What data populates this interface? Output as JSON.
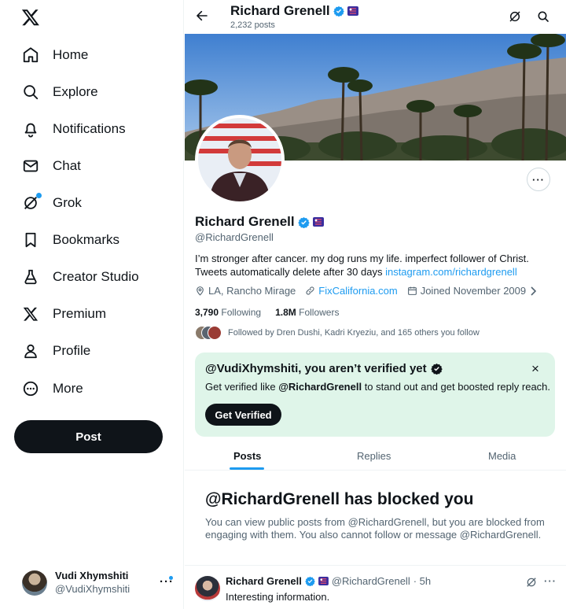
{
  "sidebar": {
    "logo": "x-logo-icon",
    "items": [
      {
        "label": "Home",
        "icon": "home-icon"
      },
      {
        "label": "Explore",
        "icon": "search-icon"
      },
      {
        "label": "Notifications",
        "icon": "bell-icon"
      },
      {
        "label": "Chat",
        "icon": "mail-icon"
      },
      {
        "label": "Grok",
        "icon": "grok-icon"
      },
      {
        "label": "Bookmarks",
        "icon": "bookmark-icon"
      },
      {
        "label": "Creator Studio",
        "icon": "flask-icon"
      },
      {
        "label": "Premium",
        "icon": "x-logo-icon"
      },
      {
        "label": "Profile",
        "icon": "person-icon"
      },
      {
        "label": "More",
        "icon": "more-circle-icon"
      }
    ],
    "post_label": "Post",
    "account": {
      "name": "Vudi Xhymshiti",
      "handle": "@VudiXhymshiti",
      "more": "···"
    }
  },
  "topbar": {
    "name": "Richard Grenell",
    "posts_count": "2,232 posts"
  },
  "profile": {
    "name": "Richard Grenell",
    "handle": "@RichardGrenell",
    "bio_text": "I’m stronger after cancer. my dog runs my life. imperfect follower of Christ. Tweets automatically delete after 30 days ",
    "bio_link": "instagram.com/richardgrenell",
    "location": "LA, Rancho Mirage",
    "website": "FixCalifornia.com",
    "joined": "Joined November 2009",
    "following_count": "3,790",
    "following_label": "Following",
    "followers_count": "1.8M",
    "followers_label": "Followers",
    "followed_by": "Followed by Dren Dushi, Kadri Kryeziu, and 165 others you follow",
    "more_button": "···"
  },
  "verify_card": {
    "title": "@VudiXhymshiti, you aren’t verified yet",
    "text_prefix": "Get verified like ",
    "text_handle": "@RichardGrenell",
    "text_suffix": " to stand out and get boosted reply reach.",
    "button": "Get Verified",
    "close": "×"
  },
  "tabs": [
    {
      "label": "Posts",
      "active": true
    },
    {
      "label": "Replies",
      "active": false
    },
    {
      "label": "Media",
      "active": false
    }
  ],
  "blocked": {
    "title": "@RichardGrenell has blocked you",
    "text": "You can view public posts from @RichardGrenell, but you are blocked from engaging with them. You also cannot follow or message @RichardGrenell."
  },
  "post": {
    "name": "Richard Grenell",
    "handle": "@RichardGrenell",
    "time": "· 5h",
    "body": "Interesting information.",
    "more": "···"
  },
  "colors": {
    "accent": "#1d9bf0",
    "verify_bg": "#dff5e9",
    "text": "#0f1419",
    "muted": "#536471"
  }
}
